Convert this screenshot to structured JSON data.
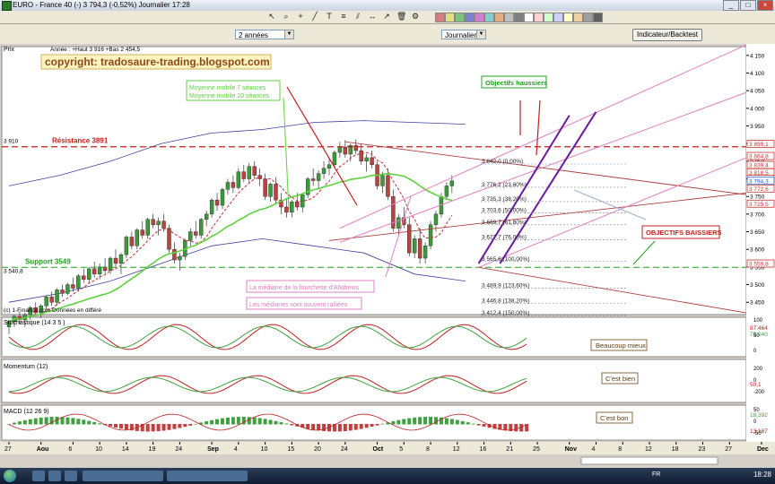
{
  "window": {
    "title": "EURO - France 40 (-)      3 794,3 (-0,52%)     Journalier   17:28"
  },
  "toolbar": {
    "icons": [
      "cursor-icon",
      "zoom-icon",
      "crosshair-icon",
      "line-tool-icon",
      "text-tool-icon",
      "fibonacci-icon",
      "channel-icon",
      "measure-icon",
      "arrow-icon",
      "trash-icon",
      "properties-icon"
    ],
    "palette": [
      "#d08080",
      "#e0e080",
      "#80c080",
      "#8080d0",
      "#d080d0",
      "#80d0d0",
      "#e0b080",
      "#c0c0c0",
      "#808080",
      "#ffffff",
      "#ffd0d0",
      "#d0ffd0",
      "#d0d0ff",
      "#ffffd0",
      "#f0d0a0",
      "#a0a0a0",
      "#606060"
    ]
  },
  "options": {
    "period": "2 années",
    "timeframe": "Journalier",
    "indicator_button": "Indicateur/Backtest"
  },
  "price_panel": {
    "label": "Prix",
    "info": "Année : +Haut 3 916  +Bas 2 454,5",
    "copyright": "copyright: tradosaure-trading.blogspot.com",
    "left_level_3910": "3 910",
    "left_level_3540": "3 540,8",
    "credit": "(c) 1-Finance.com Données en différé",
    "price_axis": [
      "4 150",
      "4 100",
      "4 050",
      "4 000",
      "3 950",
      "3 900",
      "3 850",
      "3 800",
      "3 750",
      "3 700",
      "3 650",
      "3 600",
      "3 550",
      "3 500",
      "3 450"
    ],
    "price_badges": [
      {
        "v": "3 899,1",
        "color": "#c83232"
      },
      {
        "v": "3 864,8",
        "color": "#c83232"
      },
      {
        "v": "3 839,4",
        "color": "#c83232"
      },
      {
        "v": "3 818,5",
        "color": "#c83232"
      },
      {
        "v": "3 800",
        "color": "#c83232"
      },
      {
        "v": "3 794,3",
        "color": "#1a5fd0"
      },
      {
        "v": "3 772,6",
        "color": "#c83232"
      },
      {
        "v": "3 729,5",
        "color": "#c83232"
      },
      {
        "v": "3 559,8",
        "color": "#c83232"
      }
    ]
  },
  "annotations": {
    "resistance": "Résistance 3891",
    "support": "Support 3549",
    "mm": "Moyenne mobile 7 séances\nMoyenne mobile 20 séances",
    "obj_haussiers": "Objectifs haussiers",
    "obj_baissiers": "OBJECTIFS BAISSIERS",
    "median1": "La médiane de la fourchette d'ANdrews",
    "median2": "Les médianes sont souvent ralliées"
  },
  "fibo": [
    "3 842,0 (0,00%)",
    "3 776,2 (23,60%)",
    "3 735,3 (38,20%)",
    "3 703,6 (50,00%)",
    "3 669,7 (61,80%)",
    "3 627,7 (76,00%)",
    "3 565,6 (100,00%)",
    "3 489,9 (123,60%)",
    "3 446,8 (138,20%)",
    "3 412,4 (150,00%)"
  ],
  "stoch": {
    "label": "Stochastique (14 3 5 )",
    "badges": [
      "87,464",
      "73,040"
    ],
    "comment": "Beaucoup mieux",
    "axis": [
      "100",
      "50",
      "0"
    ]
  },
  "momentum": {
    "label": "Momentum (12)",
    "badge": "50,1",
    "comment": "C'est bien",
    "axis": [
      "200",
      "0",
      "-200"
    ]
  },
  "macd": {
    "label": "MACD (12 26 9)",
    "badges": [
      "18,392",
      "13,167"
    ],
    "comment": "C'est bon",
    "axis": [
      "50",
      "0",
      "-50"
    ]
  },
  "xaxis": [
    {
      "t": "27",
      "i": 0
    },
    {
      "t": "Aou",
      "i": 6,
      "b": 1
    },
    {
      "t": "6",
      "i": 12
    },
    {
      "t": "10",
      "i": 17
    },
    {
      "t": "14",
      "i": 22
    },
    {
      "t": "19",
      "i": 27
    },
    {
      "t": "24",
      "i": 32
    },
    {
      "t": "Sep",
      "i": 38,
      "b": 1
    },
    {
      "t": "4",
      "i": 43
    },
    {
      "t": "10",
      "i": 48
    },
    {
      "t": "15",
      "i": 53
    },
    {
      "t": "20",
      "i": 58
    },
    {
      "t": "24",
      "i": 63
    },
    {
      "t": "Oct",
      "i": 69,
      "b": 1
    },
    {
      "t": "5",
      "i": 74
    },
    {
      "t": "8",
      "i": 79
    },
    {
      "t": "12",
      "i": 84
    },
    {
      "t": "16",
      "i": 89
    },
    {
      "t": "21",
      "i": 94
    },
    {
      "t": "25",
      "i": 99
    },
    {
      "t": "Nov",
      "i": 105,
      "b": 1
    },
    {
      "t": "4",
      "i": 110
    },
    {
      "t": "8",
      "i": 115
    },
    {
      "t": "12",
      "i": 120
    },
    {
      "t": "18",
      "i": 125
    },
    {
      "t": "23",
      "i": 130
    },
    {
      "t": "27",
      "i": 135
    },
    {
      "t": "Dec",
      "i": 141,
      "b": 1
    },
    {
      "t": "4",
      "i": 146
    },
    {
      "t": "9",
      "i": 151
    },
    {
      "t": "15",
      "i": 156
    },
    {
      "t": "19",
      "i": 161
    },
    {
      "t": "24",
      "i": 166
    },
    {
      "t": "2010",
      "i": 174,
      "b": 1
    }
  ],
  "taskbar": {
    "lang": "FR",
    "clock": "18:28"
  },
  "chart_data": {
    "type": "candlestick",
    "title": "EURO - France 40",
    "ylim": [
      3415,
      4175
    ],
    "candles": [
      [
        3380,
        3400,
        3360,
        3395
      ],
      [
        3395,
        3415,
        3380,
        3410
      ],
      [
        3410,
        3425,
        3390,
        3400
      ],
      [
        3400,
        3420,
        3380,
        3415
      ],
      [
        3415,
        3440,
        3400,
        3435
      ],
      [
        3435,
        3450,
        3415,
        3420
      ],
      [
        3420,
        3445,
        3405,
        3440
      ],
      [
        3440,
        3470,
        3430,
        3465
      ],
      [
        3465,
        3480,
        3440,
        3450
      ],
      [
        3450,
        3490,
        3440,
        3485
      ],
      [
        3485,
        3500,
        3465,
        3475
      ],
      [
        3475,
        3505,
        3470,
        3500
      ],
      [
        3500,
        3520,
        3480,
        3490
      ],
      [
        3490,
        3530,
        3480,
        3525
      ],
      [
        3525,
        3545,
        3505,
        3515
      ],
      [
        3515,
        3550,
        3505,
        3545
      ],
      [
        3545,
        3565,
        3520,
        3530
      ],
      [
        3530,
        3560,
        3515,
        3550
      ],
      [
        3550,
        3575,
        3530,
        3540
      ],
      [
        3540,
        3580,
        3530,
        3575
      ],
      [
        3575,
        3600,
        3550,
        3560
      ],
      [
        3560,
        3590,
        3530,
        3585
      ],
      [
        3585,
        3640,
        3575,
        3635
      ],
      [
        3635,
        3650,
        3600,
        3610
      ],
      [
        3610,
        3660,
        3600,
        3655
      ],
      [
        3655,
        3680,
        3630,
        3640
      ],
      [
        3640,
        3690,
        3630,
        3685
      ],
      [
        3685,
        3700,
        3660,
        3670
      ],
      [
        3670,
        3690,
        3640,
        3680
      ],
      [
        3680,
        3700,
        3650,
        3660
      ],
      [
        3660,
        3670,
        3590,
        3600
      ],
      [
        3600,
        3620,
        3560,
        3570
      ],
      [
        3570,
        3590,
        3540,
        3580
      ],
      [
        3580,
        3630,
        3570,
        3625
      ],
      [
        3625,
        3660,
        3610,
        3650
      ],
      [
        3650,
        3680,
        3630,
        3640
      ],
      [
        3640,
        3690,
        3630,
        3685
      ],
      [
        3685,
        3710,
        3665,
        3700
      ],
      [
        3700,
        3745,
        3690,
        3740
      ],
      [
        3740,
        3760,
        3710,
        3725
      ],
      [
        3725,
        3775,
        3715,
        3770
      ],
      [
        3770,
        3800,
        3755,
        3790
      ],
      [
        3790,
        3810,
        3760,
        3775
      ],
      [
        3775,
        3830,
        3770,
        3820
      ],
      [
        3820,
        3840,
        3790,
        3800
      ],
      [
        3800,
        3845,
        3790,
        3835
      ],
      [
        3835,
        3850,
        3800,
        3810
      ],
      [
        3810,
        3830,
        3780,
        3800
      ],
      [
        3800,
        3815,
        3740,
        3750
      ],
      [
        3750,
        3790,
        3735,
        3785
      ],
      [
        3785,
        3805,
        3730,
        3740
      ],
      [
        3740,
        3760,
        3700,
        3720
      ],
      [
        3720,
        3745,
        3690,
        3705
      ],
      [
        3705,
        3740,
        3690,
        3735
      ],
      [
        3735,
        3760,
        3710,
        3720
      ],
      [
        3720,
        3760,
        3705,
        3755
      ],
      [
        3755,
        3805,
        3745,
        3800
      ],
      [
        3800,
        3830,
        3780,
        3795
      ],
      [
        3795,
        3825,
        3770,
        3815
      ],
      [
        3815,
        3850,
        3800,
        3830
      ],
      [
        3830,
        3860,
        3810,
        3840
      ],
      [
        3840,
        3880,
        3830,
        3875
      ],
      [
        3875,
        3905,
        3860,
        3890
      ],
      [
        3890,
        3910,
        3860,
        3870
      ],
      [
        3870,
        3900,
        3850,
        3895
      ],
      [
        3895,
        3912,
        3870,
        3880
      ],
      [
        3880,
        3900,
        3840,
        3850
      ],
      [
        3850,
        3870,
        3820,
        3860
      ],
      [
        3860,
        3880,
        3830,
        3840
      ],
      [
        3840,
        3850,
        3770,
        3780
      ],
      [
        3780,
        3820,
        3760,
        3810
      ],
      [
        3810,
        3830,
        3740,
        3750
      ],
      [
        3750,
        3770,
        3650,
        3660
      ],
      [
        3660,
        3700,
        3640,
        3690
      ],
      [
        3690,
        3720,
        3660,
        3670
      ],
      [
        3670,
        3690,
        3580,
        3590
      ],
      [
        3590,
        3640,
        3575,
        3630
      ],
      [
        3630,
        3660,
        3560,
        3575
      ],
      [
        3575,
        3620,
        3560,
        3610
      ],
      [
        3610,
        3680,
        3600,
        3670
      ],
      [
        3670,
        3710,
        3650,
        3700
      ],
      [
        3700,
        3760,
        3690,
        3750
      ],
      [
        3750,
        3790,
        3740,
        3780
      ],
      [
        3780,
        3810,
        3760,
        3794
      ]
    ],
    "series": [
      {
        "name": "MM7",
        "values": []
      },
      {
        "name": "MM20",
        "values": []
      }
    ],
    "levels": {
      "resistance": 3891,
      "support": 3549
    },
    "legend": "none"
  }
}
